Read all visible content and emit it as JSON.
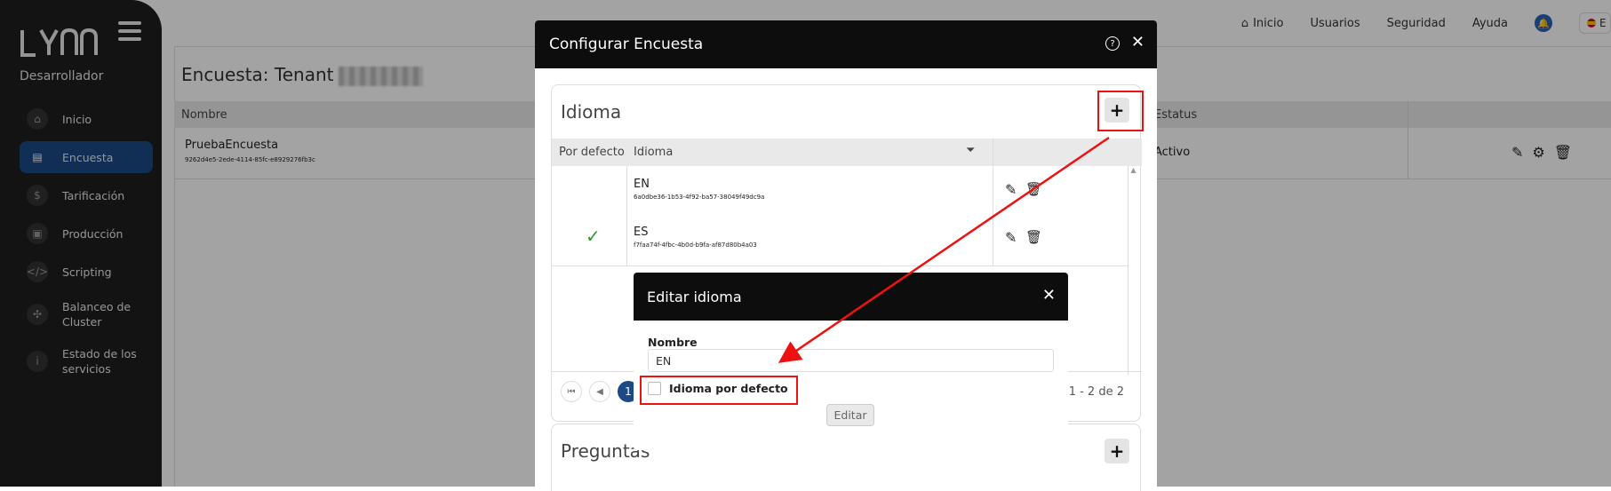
{
  "sidebar": {
    "logo": "LYNN",
    "role": "Desarrollador",
    "items": [
      {
        "label": "Inicio",
        "icon": "home-icon"
      },
      {
        "label": "Encuesta",
        "icon": "clipboard-icon"
      },
      {
        "label": "Tarificación",
        "icon": "dollar-icon"
      },
      {
        "label": "Producción",
        "icon": "briefcase-icon"
      },
      {
        "label": "Scripting",
        "icon": "code-icon"
      },
      {
        "label": "Balanceo de Cluster",
        "icon": "cluster-icon"
      },
      {
        "label": "Estado de los servicios",
        "icon": "info-icon"
      }
    ]
  },
  "topnav": {
    "home": "Inicio",
    "users": "Usuarios",
    "security": "Seguridad",
    "help": "Ayuda",
    "language": "E"
  },
  "page": {
    "title": "Encuesta: Tenant",
    "columns": {
      "name": "Nombre",
      "status": "Estatus"
    },
    "row": {
      "name": "PruebaEncuesta",
      "uuid": "9262d4e5-2ede-4114-85fc-e8929276fb3c",
      "status": "Activo"
    }
  },
  "config_modal": {
    "title": "Configurar Encuesta",
    "language_section": {
      "title": "Idioma",
      "columns": {
        "default": "Por defecto",
        "language": "Idioma"
      },
      "rows": [
        {
          "code": "EN",
          "uuid": "6a0dbe36-1b53-4f92-ba57-38049f49dc9a",
          "default": false
        },
        {
          "code": "ES",
          "uuid": "f7faa74f-4fbc-4b0d-b9fa-af87d80b4a03",
          "default": true
        }
      ],
      "pagination": {
        "current": "1",
        "info": "Registros 1 - 2 de 2"
      }
    },
    "questions_section": {
      "title": "Preguntas"
    }
  },
  "edit_modal": {
    "title": "Editar idioma",
    "name_label": "Nombre",
    "name_value": "EN",
    "default_label": "Idioma por defecto",
    "default_checked": false,
    "submit": "Editar"
  },
  "annotation_color": "#e11111"
}
